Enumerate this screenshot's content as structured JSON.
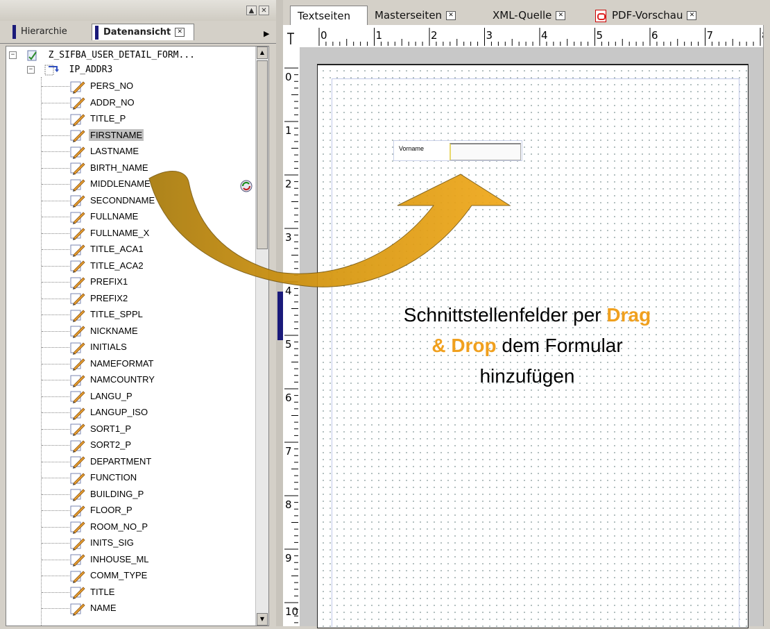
{
  "left_panel": {
    "tabs": {
      "hierarchy": "Hierarchie",
      "data_view": "Datenansicht"
    },
    "tree": {
      "root": "Z_SIFBA_USER_DETAIL_FORM...",
      "node": "IP_ADDR3",
      "items": [
        "PERS_NO",
        "ADDR_NO",
        "TITLE_P",
        "FIRSTNAME",
        "LASTNAME",
        "BIRTH_NAME",
        "MIDDLENAME",
        "SECONDNAME",
        "FULLNAME",
        "FULLNAME_X",
        "TITLE_ACA1",
        "TITLE_ACA2",
        "PREFIX1",
        "PREFIX2",
        "TITLE_SPPL",
        "NICKNAME",
        "INITIALS",
        "NAMEFORMAT",
        "NAMCOUNTRY",
        "LANGU_P",
        "LANGUP_ISO",
        "SORT1_P",
        "SORT2_P",
        "DEPARTMENT",
        "FUNCTION",
        "BUILDING_P",
        "FLOOR_P",
        "ROOM_NO_P",
        "INITS_SIG",
        "INHOUSE_ML",
        "COMM_TYPE",
        "TITLE",
        "NAME"
      ],
      "selected": "FIRSTNAME"
    }
  },
  "tabs": {
    "text_pages": "Textseiten",
    "master_pages": "Masterseiten",
    "xml_source": "XML-Quelle",
    "pdf_preview": "PDF-Vorschau"
  },
  "ruler": {
    "horizontal": [
      "0",
      "1",
      "2",
      "3",
      "4",
      "5",
      "6",
      "7",
      "8"
    ],
    "vertical": [
      "0",
      "1",
      "2",
      "3",
      "4",
      "5",
      "6",
      "7",
      "8",
      "9",
      "10"
    ]
  },
  "form": {
    "field_label": "Vorname"
  },
  "callout": {
    "part1": "Schnittstellenfelder per ",
    "highlight1": "Drag",
    "highlight2": "& Drop",
    "part2": " dem Formular",
    "part3": "hinzufügen"
  },
  "colors": {
    "accent": "#f0a01e",
    "arrow": "#e8a40c",
    "selection": "#c0c0c0",
    "tab_bar": "#1a1a7a"
  }
}
